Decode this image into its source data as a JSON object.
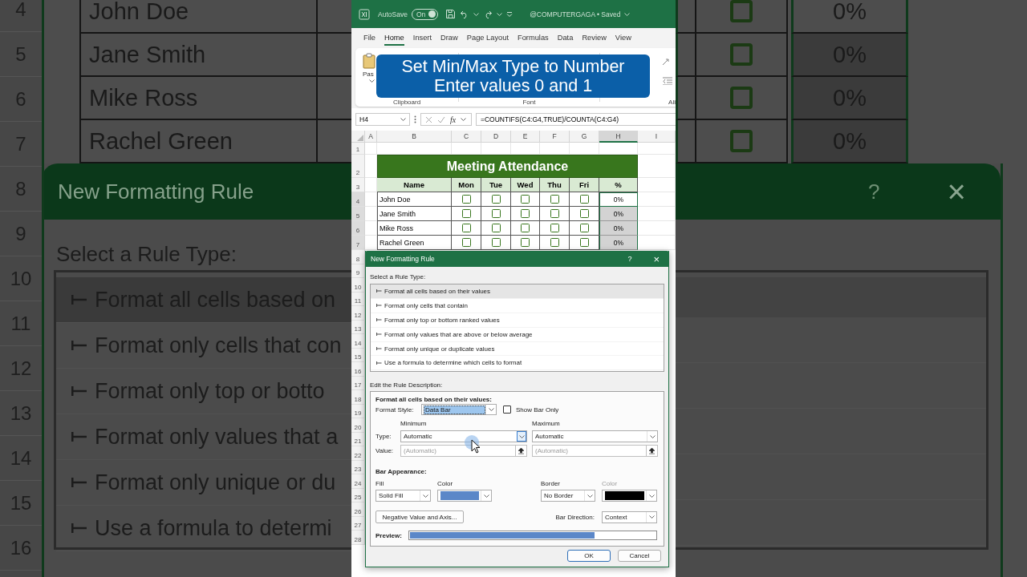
{
  "backdrop": {
    "left": {
      "row_numbers": [
        "4",
        "5",
        "6",
        "7",
        "8",
        "9",
        "10",
        "11",
        "12",
        "13",
        "14",
        "15",
        "16"
      ],
      "names": [
        "John Doe",
        "Jane Smith",
        "Mike Ross",
        "Rachel Green"
      ],
      "dialog_title": "New Formatting Rule",
      "rule_type_label": "Select a Rule Type:",
      "rule_types": [
        {
          "label": "Format all cells based on",
          "selected": true
        },
        {
          "label": "Format only cells that con",
          "selected": false
        },
        {
          "label": "Format only top or botto",
          "selected": false
        },
        {
          "label": "Format only values that a",
          "selected": false
        },
        {
          "label": "Format only unique or du",
          "selected": false
        },
        {
          "label": "Use a formula to determi",
          "selected": false
        }
      ]
    },
    "right": {
      "rows": [
        {
          "checked": false,
          "percent": "0%",
          "active": true
        },
        {
          "checked": false,
          "percent": "0%",
          "active": false
        },
        {
          "checked": false,
          "percent": "0%",
          "active": false
        },
        {
          "checked": false,
          "percent": "0%",
          "active": false
        }
      ],
      "help": "?",
      "close": "×"
    }
  },
  "title_bar": {
    "autosave_label": "AutoSave",
    "autosave": {
      "label": "On",
      "on": true
    },
    "document": "@COMPUTERGAGA • Saved"
  },
  "ribbon_tabs": [
    {
      "label": "File",
      "selected": false
    },
    {
      "label": "Home",
      "selected": true
    },
    {
      "label": "Insert",
      "selected": false
    },
    {
      "label": "Draw",
      "selected": false
    },
    {
      "label": "Page Layout",
      "selected": false
    },
    {
      "label": "Formulas",
      "selected": false
    },
    {
      "label": "Data",
      "selected": false
    },
    {
      "label": "Review",
      "selected": false
    },
    {
      "label": "View",
      "selected": false
    }
  ],
  "ribbon": {
    "paste_label": "Pas",
    "groups": [
      "Clipboard",
      "Font",
      "Ali"
    ]
  },
  "caption": {
    "lines": [
      "Set Min/Max Type to Number",
      "Enter values 0 and 1"
    ]
  },
  "formula_bar": {
    "name_box": "H4",
    "function_label": "fx",
    "formula": "=COUNTIFS(C4:G4,TRUE)/COUNTA(C4:G4)"
  },
  "sheet": {
    "columns": [
      {
        "label": "A",
        "selected": false
      },
      {
        "label": "B",
        "selected": false
      },
      {
        "label": "C",
        "selected": false
      },
      {
        "label": "D",
        "selected": false
      },
      {
        "label": "E",
        "selected": false
      },
      {
        "label": "F",
        "selected": false
      },
      {
        "label": "G",
        "selected": false
      },
      {
        "label": "H",
        "selected": true
      },
      {
        "label": "I",
        "selected": false
      }
    ],
    "row_numbers": [
      {
        "label": "1",
        "selected": false
      },
      {
        "label": "2",
        "selected": false
      },
      {
        "label": "3",
        "selected": false
      },
      {
        "label": "4",
        "selected": true
      },
      {
        "label": "5",
        "selected": true
      },
      {
        "label": "6",
        "selected": true
      },
      {
        "label": "7",
        "selected": true
      },
      {
        "label": "8",
        "selected": false
      },
      {
        "label": "9",
        "selected": false
      },
      {
        "label": "10",
        "selected": false
      },
      {
        "label": "11",
        "selected": false
      },
      {
        "label": "12",
        "selected": false
      },
      {
        "label": "13",
        "selected": false
      },
      {
        "label": "14",
        "selected": false
      },
      {
        "label": "15",
        "selected": false
      },
      {
        "label": "16",
        "selected": false
      },
      {
        "label": "17",
        "selected": false
      },
      {
        "label": "18",
        "selected": false
      },
      {
        "label": "19",
        "selected": false
      },
      {
        "label": "20",
        "selected": false
      },
      {
        "label": "21",
        "selected": false
      },
      {
        "label": "22",
        "selected": false
      },
      {
        "label": "23",
        "selected": false
      },
      {
        "label": "24",
        "selected": false
      },
      {
        "label": "25",
        "selected": false
      },
      {
        "label": "26",
        "selected": false
      },
      {
        "label": "27",
        "selected": false
      },
      {
        "label": "28",
        "selected": false
      }
    ],
    "table": {
      "title": "Meeting Attendance",
      "headers": [
        "Name",
        "Mon",
        "Tue",
        "Wed",
        "Thu",
        "Fri",
        "%"
      ],
      "rows": [
        {
          "name": "John Doe",
          "days": [
            false,
            false,
            false,
            false,
            false
          ],
          "percent": "0%",
          "active": true
        },
        {
          "name": "Jane Smith",
          "days": [
            false,
            false,
            false,
            false,
            false
          ],
          "percent": "0%",
          "active": false
        },
        {
          "name": "Mike Ross",
          "days": [
            false,
            false,
            false,
            false,
            false
          ],
          "percent": "0%",
          "active": false
        },
        {
          "name": "Rachel Green",
          "days": [
            false,
            false,
            false,
            false,
            false
          ],
          "percent": "0%",
          "active": false
        }
      ]
    }
  },
  "dialog": {
    "title": "New Formatting Rule",
    "help": "?",
    "close": "×",
    "rule_type_label": "Select a Rule Type:",
    "rule_types": [
      {
        "label": "Format all cells based on their values",
        "selected": true
      },
      {
        "label": "Format only cells that contain",
        "selected": false
      },
      {
        "label": "Format only top or bottom ranked values",
        "selected": false
      },
      {
        "label": "Format only values that are above or below average",
        "selected": false
      },
      {
        "label": "Format only unique or duplicate values",
        "selected": false
      },
      {
        "label": "Use a formula to determine which cells to format",
        "selected": false
      }
    ],
    "description_label": "Edit the Rule Description:",
    "description_heading": "Format all cells based on their values:",
    "format_style": {
      "label": "Format Style:",
      "value": "Data Bar"
    },
    "show_bar_only": {
      "label": "Show Bar Only",
      "checked": false
    },
    "type_label": "Type:",
    "value_label": "Value:",
    "minimum": {
      "heading": "Minimum",
      "type": "Automatic",
      "value_placeholder": "(Automatic)"
    },
    "maximum": {
      "heading": "Maximum",
      "type": "Automatic",
      "value_placeholder": "(Automatic)"
    },
    "bar_appearance": {
      "heading": "Bar Appearance:",
      "fill_label": "Fill",
      "fill": "Solid Fill",
      "fill_color_label": "Color",
      "border_label": "Border",
      "border": "No Border",
      "border_color_label": "Color",
      "border_color_disabled": true
    },
    "negative_button": "Negative Value and Axis...",
    "bar_direction": {
      "label": "Bar Direction:",
      "value": "Context"
    },
    "preview": {
      "label": "Preview:",
      "level": 0.75
    },
    "buttons": [
      {
        "label": "OK",
        "kind": "default"
      },
      {
        "label": "Cancel",
        "kind": "normal"
      }
    ]
  }
}
